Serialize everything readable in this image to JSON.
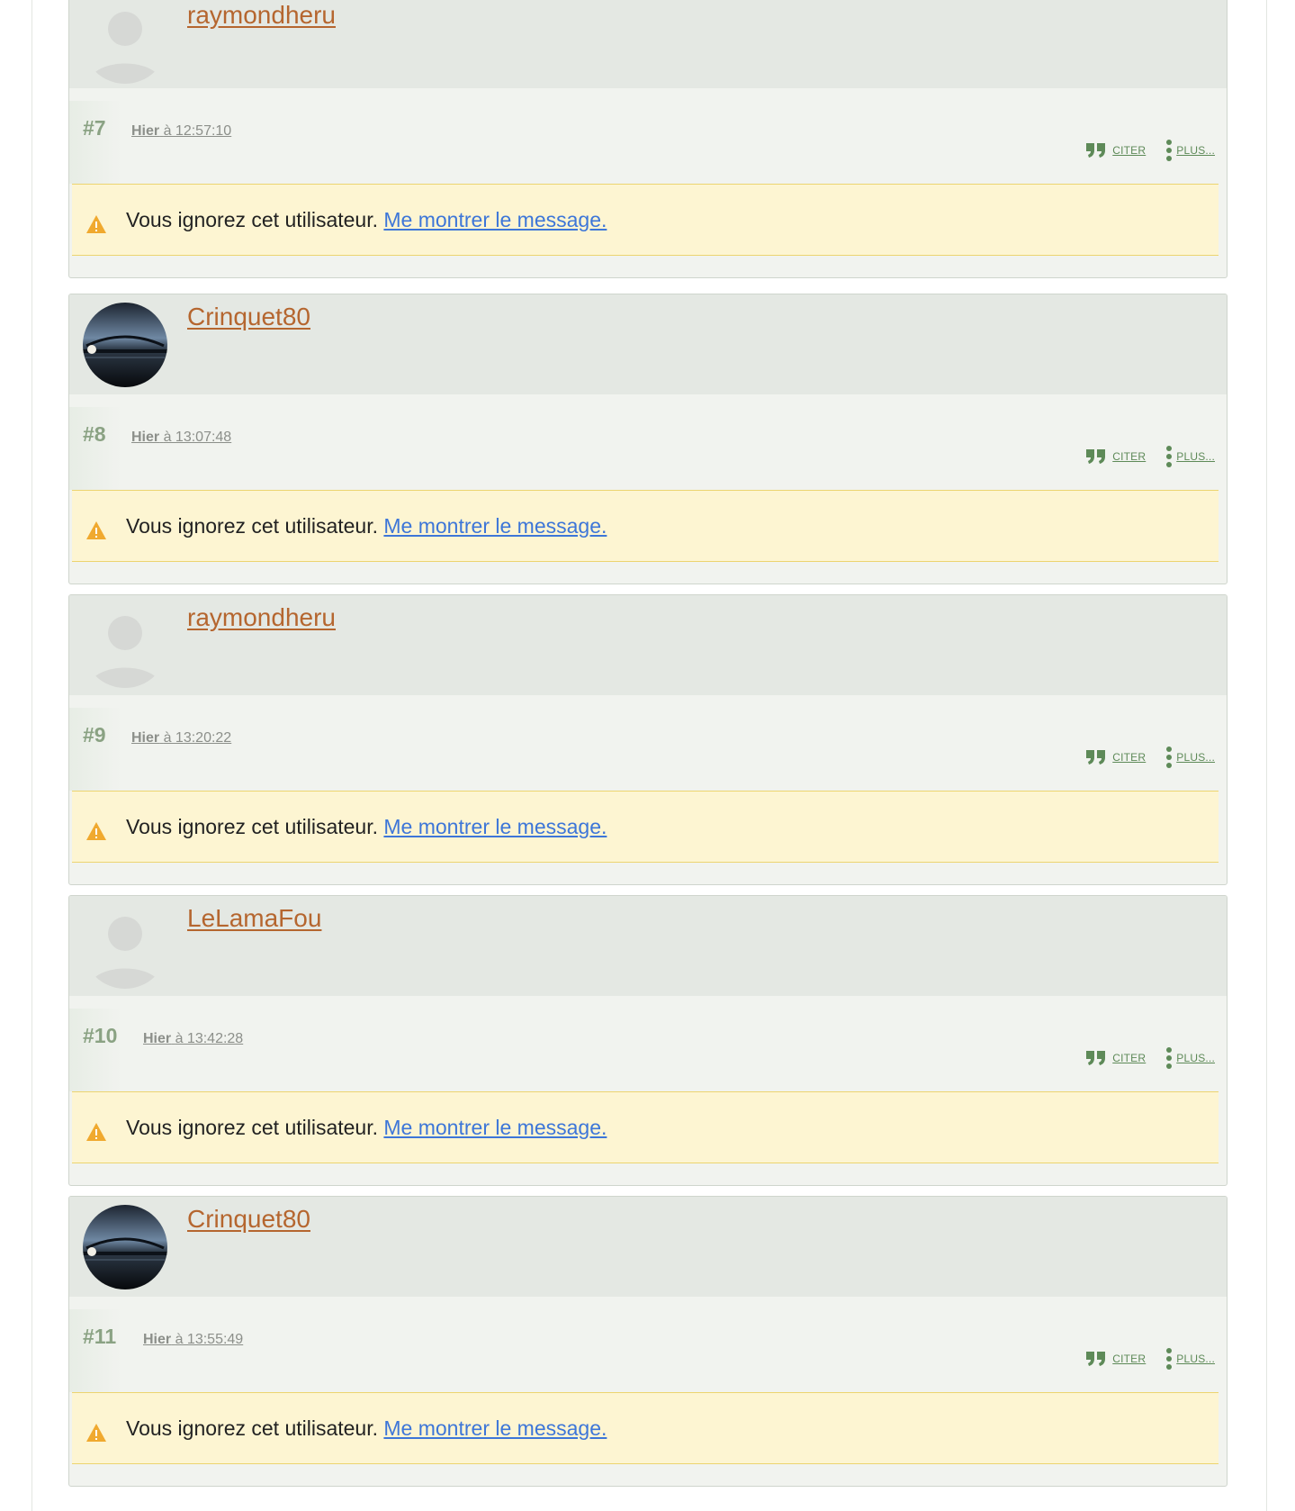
{
  "ignored_notice": {
    "text": "Vous ignorez cet utilisateur.",
    "link": "Me montrer le message."
  },
  "actions": {
    "quote_label": "CITER",
    "more_label": "PLUS..."
  },
  "posts": [
    {
      "username": "raymondheru",
      "number": "#7",
      "day": "Hier",
      "time": "à 12:57:10",
      "avatar": "default"
    },
    {
      "username": "Crinquet80",
      "number": "#8",
      "day": "Hier",
      "time": "à 13:07:48",
      "avatar": "photo"
    },
    {
      "username": "raymondheru",
      "number": "#9",
      "day": "Hier",
      "time": "à 13:20:22",
      "avatar": "default"
    },
    {
      "username": "LeLamaFou",
      "number": "#10",
      "day": "Hier",
      "time": "à 13:42:28",
      "avatar": "default"
    },
    {
      "username": "Crinquet80",
      "number": "#11",
      "day": "Hier",
      "time": "à 13:55:49",
      "avatar": "photo"
    }
  ],
  "colors": {
    "username": "#b5662f",
    "link": "#3d76d8",
    "action": "#5e8a58",
    "warning": "#f0a92f",
    "notice_bg": "#fdf5d2"
  }
}
